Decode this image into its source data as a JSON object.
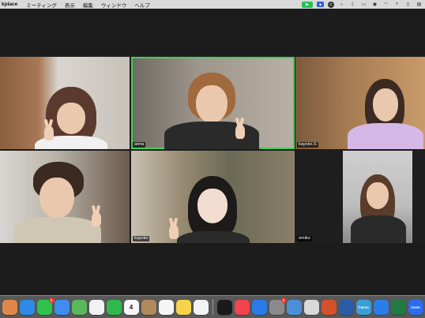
{
  "menubar": {
    "app_name": "kplace",
    "items": [
      "ミーティング",
      "表示",
      "編集",
      "ウィンドウ",
      "ヘルプ"
    ],
    "status_icons": [
      "zoom-status-icon",
      "vpn-icon",
      "sync-icon",
      "headphones-icon",
      "bluetooth-icon",
      "battery-icon",
      "control-center-icon",
      "wifi-icon",
      "search-icon",
      "display-icon",
      "menu-extra-icon"
    ]
  },
  "participants": [
    {
      "name": "",
      "speaking": false
    },
    {
      "name": "anna",
      "speaking": true
    },
    {
      "name": "kayoko.S",
      "speaking": false
    },
    {
      "name": "",
      "speaking": false
    },
    {
      "name": "kayoko",
      "speaking": false
    },
    {
      "name": "emiko",
      "speaking": false
    }
  ],
  "dock": {
    "apps": [
      {
        "icon": "launchpad-icon",
        "color": "#e0884a",
        "badge": ""
      },
      {
        "icon": "safari-icon",
        "color": "#2f8ae6",
        "badge": ""
      },
      {
        "icon": "messages-icon",
        "color": "#31c24c",
        "badge": "1"
      },
      {
        "icon": "mail-icon",
        "color": "#3d8ef0",
        "badge": ""
      },
      {
        "icon": "maps-icon",
        "color": "#5bb85d",
        "badge": ""
      },
      {
        "icon": "photos-icon",
        "color": "#f2f2f2",
        "badge": ""
      },
      {
        "icon": "facetime-icon",
        "color": "#2fb94a",
        "badge": ""
      },
      {
        "icon": "calendar-icon",
        "color": "#f7f7f7",
        "badge": "",
        "text": "4"
      },
      {
        "icon": "contacts-icon",
        "color": "#b08a5a",
        "badge": ""
      },
      {
        "icon": "reminders-icon",
        "color": "#f5f5f5",
        "badge": ""
      },
      {
        "icon": "notes-icon",
        "color": "#f6d34a",
        "badge": ""
      },
      {
        "icon": "freeform-icon",
        "color": "#f3f3f3",
        "badge": ""
      },
      {
        "icon": "tv-icon",
        "color": "#1a1a1a",
        "badge": ""
      },
      {
        "icon": "music-icon",
        "color": "#f2434f",
        "badge": ""
      },
      {
        "icon": "app-store-icon",
        "color": "#2a7be8",
        "badge": ""
      },
      {
        "icon": "system-settings-icon",
        "color": "#8a8a8a",
        "badge": "1"
      },
      {
        "icon": "preview-icon",
        "color": "#4b8fd6",
        "badge": ""
      },
      {
        "icon": "scripts-icon",
        "color": "#d9d9d9",
        "badge": ""
      },
      {
        "icon": "powerpoint-icon",
        "color": "#d4512c",
        "badge": ""
      },
      {
        "icon": "word-icon",
        "color": "#2a5caa",
        "badge": ""
      },
      {
        "icon": "canva-icon",
        "color": "#3a9fd9",
        "badge": "",
        "text": "Canva"
      },
      {
        "icon": "bluetooth-app-icon",
        "color": "#2b7de9",
        "badge": ""
      },
      {
        "icon": "excel-icon",
        "color": "#1f7a43",
        "badge": ""
      },
      {
        "icon": "zoom-app-icon",
        "color": "#2d6cf0",
        "badge": "",
        "text": "zoom"
      }
    ]
  }
}
